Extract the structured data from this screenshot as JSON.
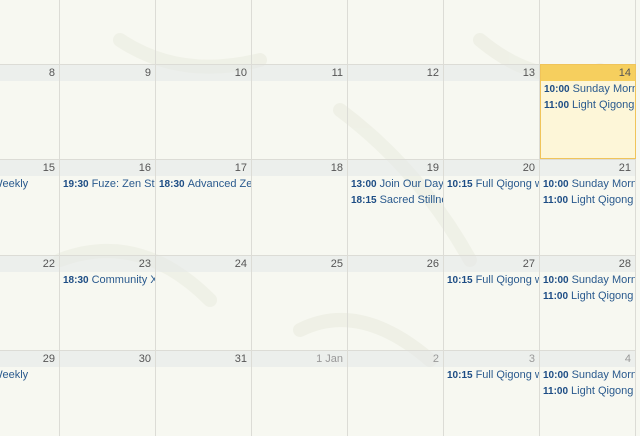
{
  "weeks": [
    {
      "days": [
        {
          "num": "",
          "events": []
        },
        {
          "num": "",
          "events": []
        },
        {
          "num": "",
          "events": []
        },
        {
          "num": "",
          "events": []
        },
        {
          "num": "",
          "events": []
        },
        {
          "num": "",
          "events": []
        },
        {
          "num": "",
          "events": []
        }
      ]
    },
    {
      "days": [
        {
          "num": "8",
          "events": []
        },
        {
          "num": "9",
          "events": []
        },
        {
          "num": "10",
          "events": []
        },
        {
          "num": "11",
          "events": []
        },
        {
          "num": "12",
          "events": []
        },
        {
          "num": "13",
          "events": []
        },
        {
          "num": "14",
          "today": true,
          "events": [
            {
              "time": "10:00",
              "title": "Sunday Morning"
            },
            {
              "time": "11:00",
              "title": "Light Qigong"
            }
          ]
        }
      ]
    },
    {
      "days": [
        {
          "num": "15",
          "events": [
            {
              "time": "",
              "title": "Your Weekly"
            }
          ]
        },
        {
          "num": "16",
          "events": [
            {
              "time": "19:30",
              "title": "Fuze: Zen Stretch"
            }
          ]
        },
        {
          "num": "17",
          "events": [
            {
              "time": "18:30",
              "title": "Advanced Zen"
            }
          ]
        },
        {
          "num": "18",
          "events": []
        },
        {
          "num": "19",
          "events": [
            {
              "time": "13:00",
              "title": "Join Our Day"
            },
            {
              "time": "18:15",
              "title": "Sacred Stillness"
            }
          ]
        },
        {
          "num": "20",
          "events": [
            {
              "time": "10:15",
              "title": "Full Qigong w"
            }
          ]
        },
        {
          "num": "21",
          "events": [
            {
              "time": "10:00",
              "title": "Sunday Morning"
            },
            {
              "time": "11:00",
              "title": "Light Qigong"
            }
          ]
        }
      ]
    },
    {
      "days": [
        {
          "num": "22",
          "events": []
        },
        {
          "num": "23",
          "events": [
            {
              "time": "18:30",
              "title": "Community X"
            }
          ]
        },
        {
          "num": "24",
          "events": []
        },
        {
          "num": "25",
          "events": []
        },
        {
          "num": "26",
          "events": []
        },
        {
          "num": "27",
          "events": [
            {
              "time": "10:15",
              "title": "Full Qigong w"
            }
          ]
        },
        {
          "num": "28",
          "events": [
            {
              "time": "10:00",
              "title": "Sunday Morning"
            },
            {
              "time": "11:00",
              "title": "Light Qigong"
            }
          ]
        }
      ]
    },
    {
      "days": [
        {
          "num": "29",
          "events": [
            {
              "time": "",
              "title": "Your Weekly"
            }
          ]
        },
        {
          "num": "30",
          "events": []
        },
        {
          "num": "31",
          "events": []
        },
        {
          "num": "1 Jan",
          "other": true,
          "events": []
        },
        {
          "num": "2",
          "other": true,
          "events": []
        },
        {
          "num": "3",
          "other": true,
          "events": [
            {
              "time": "10:15",
              "title": "Full Qigong w"
            }
          ]
        },
        {
          "num": "4",
          "other": true,
          "events": [
            {
              "time": "10:00",
              "title": "Sunday Morning"
            },
            {
              "time": "11:00",
              "title": "Light Qigong"
            }
          ]
        }
      ]
    }
  ]
}
